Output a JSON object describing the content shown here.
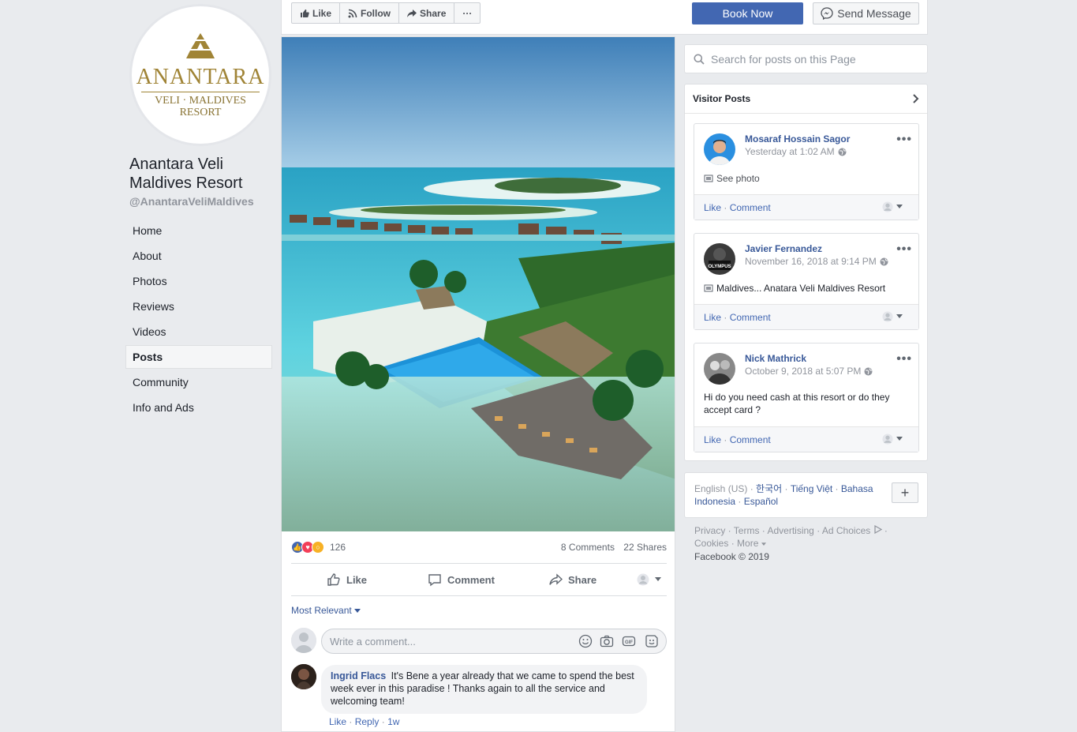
{
  "page": {
    "logo_brand": "ANANTARA",
    "logo_sub_line1": "VELI · MALDIVES",
    "logo_sub_line2": "RESORT",
    "name": "Anantara Veli Maldives Resort",
    "handle": "@AnantaraVeliMaldives"
  },
  "left_nav": [
    {
      "label": "Home",
      "active": false
    },
    {
      "label": "About",
      "active": false
    },
    {
      "label": "Photos",
      "active": false
    },
    {
      "label": "Reviews",
      "active": false
    },
    {
      "label": "Videos",
      "active": false
    },
    {
      "label": "Posts",
      "active": true
    },
    {
      "label": "Community",
      "active": false
    },
    {
      "label": "Info and Ads",
      "active": false
    }
  ],
  "top_bar": {
    "like_label": "Like",
    "follow_label": "Follow",
    "share_label": "Share",
    "more_label": "···",
    "book_now_label": "Book Now",
    "send_message_label": "Send Message"
  },
  "post": {
    "reaction_count": "126",
    "comments_count": "8 Comments",
    "shares_count": "22 Shares",
    "like_label": "Like",
    "comment_label": "Comment",
    "share_label": "Share",
    "sort_label": "Most Relevant",
    "comment_placeholder": "Write a comment...",
    "comments": [
      {
        "author": "Ingrid Flacs",
        "text": "It's Bene a year already that we came to spend the best week ever in this paradise ! Thanks again to all the service and welcoming team!",
        "like_label": "Like",
        "reply_label": "Reply",
        "age": "1w"
      }
    ]
  },
  "sidebar": {
    "search_placeholder": "Search for posts on this Page",
    "visitor_posts_title": "Visitor Posts",
    "visitor_posts": [
      {
        "author": "Mosaraf Hossain Sagor",
        "time": "Yesterday at 1:02 AM",
        "body": "See photo",
        "like_label": "Like",
        "comment_label": "Comment"
      },
      {
        "author": "Javier Fernandez",
        "time": "November 16, 2018 at 9:14 PM",
        "body": "Maldives... Anatara Veli Maldives Resort",
        "like_label": "Like",
        "comment_label": "Comment"
      },
      {
        "author": "Nick Mathrick",
        "time": "October 9, 2018 at 5:07 PM",
        "body": "Hi do you need cash at this resort or do they accept card ?",
        "like_label": "Like",
        "comment_label": "Comment"
      }
    ],
    "languages_current": "English (US)",
    "languages": [
      "한국어",
      "Tiếng Việt",
      "Bahasa Indonesia",
      "Español"
    ],
    "lang_add_label": "+",
    "footer_links": [
      "Privacy",
      "Terms",
      "Advertising",
      "Ad Choices",
      "Cookies",
      "More"
    ],
    "copyright": "Facebook © 2019"
  },
  "colors": {
    "fb_blue": "#4267b2",
    "link": "#385898",
    "background": "#e9ebee",
    "logo_gold": "#a08436"
  }
}
